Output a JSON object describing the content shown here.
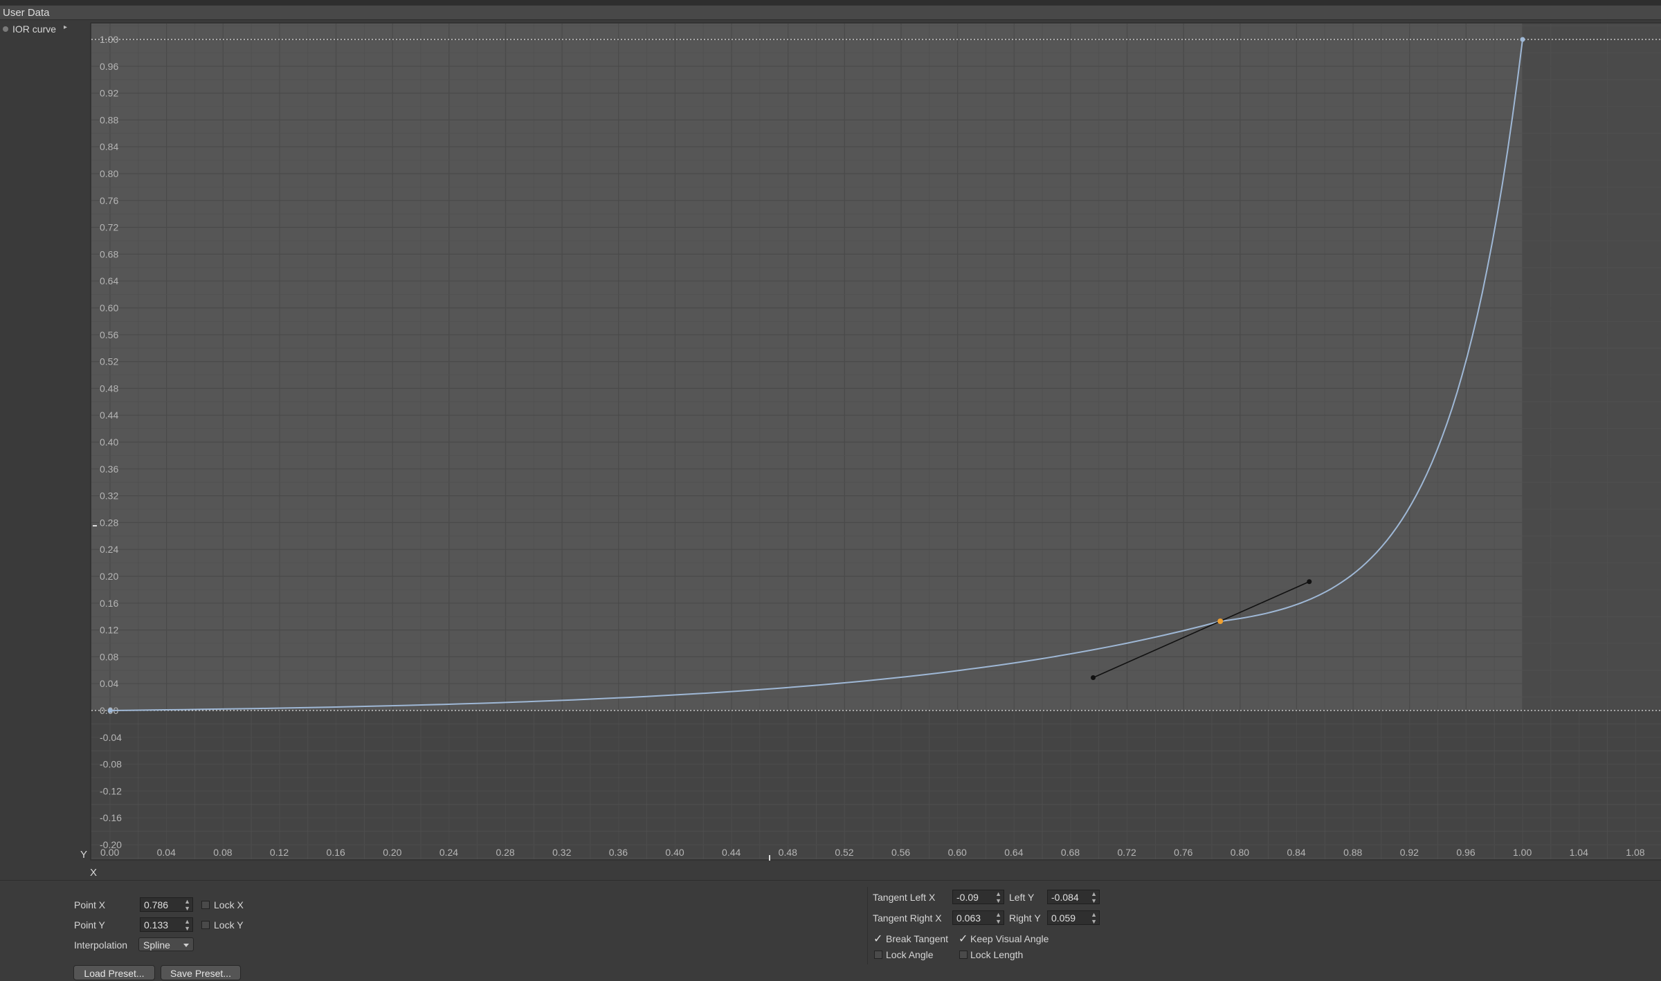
{
  "panel": {
    "title": "User Data"
  },
  "sidebar": {
    "item_label": "IOR curve"
  },
  "graph": {
    "x_ticks": [
      "0.00",
      "0.04",
      "0.08",
      "0.12",
      "0.16",
      "0.20",
      "0.24",
      "0.28",
      "0.32",
      "0.36",
      "0.40",
      "0.44",
      "0.48",
      "0.52",
      "0.56",
      "0.60",
      "0.64",
      "0.68",
      "0.72",
      "0.76",
      "0.80",
      "0.84",
      "0.88",
      "0.92",
      "0.96",
      "1.00",
      "1.04",
      "1.08"
    ],
    "y_ticks": [
      "1.00",
      "0.96",
      "0.92",
      "0.88",
      "0.84",
      "0.80",
      "0.76",
      "0.72",
      "0.68",
      "0.64",
      "0.60",
      "0.56",
      "0.52",
      "0.48",
      "0.44",
      "0.40",
      "0.36",
      "0.32",
      "0.28",
      "0.24",
      "0.20",
      "0.16",
      "0.12",
      "0.08",
      "0.04",
      "0.00",
      "-0.04",
      "-0.08",
      "-0.12",
      "-0.16",
      "-0.20"
    ],
    "x_axis_letter": "X",
    "y_axis_letter": "Y",
    "curve_points": [
      {
        "x": 0.0,
        "y": 0.0
      },
      {
        "x": 0.786,
        "y": 0.133
      },
      {
        "x": 1.0,
        "y": 1.0
      }
    ],
    "selected_point": {
      "x": 0.786,
      "y": 0.133
    },
    "colors": {
      "curve": "#9fb8d6",
      "selected_point": "#f0a030",
      "tangent": "#111111"
    }
  },
  "controls": {
    "point_x_label": "Point X",
    "point_x_value": "0.786",
    "lock_x_label": "Lock X",
    "point_y_label": "Point Y",
    "point_y_value": "0.133",
    "lock_y_label": "Lock Y",
    "interpolation_label": "Interpolation",
    "interpolation_value": "Spline",
    "load_preset": "Load Preset...",
    "save_preset": "Save Preset...",
    "tangent_left_x_label": "Tangent Left X",
    "tangent_left_x_value": "-0.09",
    "left_y_label": "Left Y",
    "left_y_value": "-0.084",
    "tangent_right_x_label": "Tangent Right X",
    "tangent_right_x_value": "0.063",
    "right_y_label": "Right Y",
    "right_y_value": "0.059",
    "break_tangent_label": "Break Tangent",
    "break_tangent_checked": true,
    "keep_visual_angle_label": "Keep Visual Angle",
    "keep_visual_angle_checked": true,
    "lock_angle_label": "Lock Angle",
    "lock_angle_checked": false,
    "lock_length_label": "Lock Length",
    "lock_length_checked": false
  }
}
